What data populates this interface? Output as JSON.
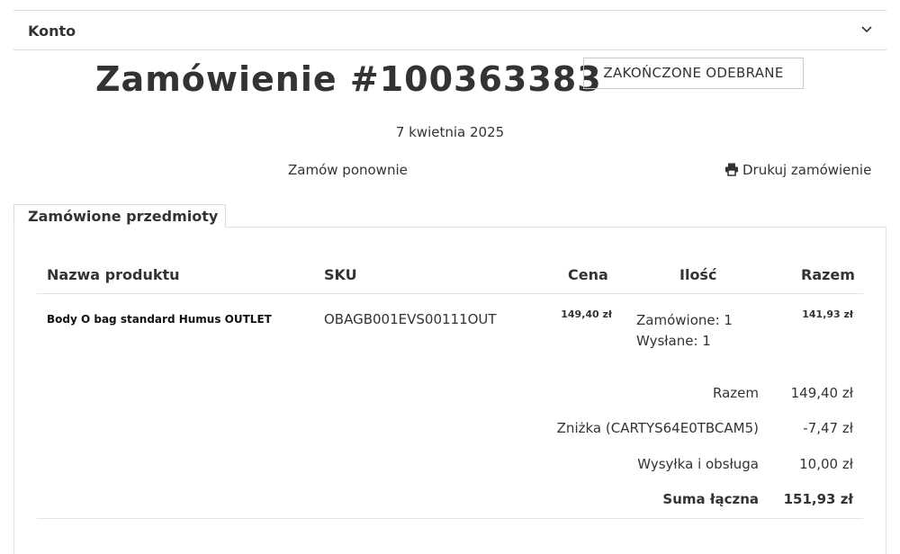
{
  "account": {
    "label": "Konto",
    "toggle_icon": "chevron-down-icon"
  },
  "order": {
    "title": "Zamówienie #100363383",
    "status": "ZAKOŃCZONE ODEBRANE",
    "date": "7 kwietnia 2025",
    "reorder_label": "Zamów ponownie",
    "print_label": "Drukuj zamówienie",
    "print_icon": "printer-icon"
  },
  "tabs": {
    "items_label": "Zamówione przedmioty"
  },
  "table": {
    "headers": {
      "name": "Nazwa produktu",
      "sku": "SKU",
      "price": "Cena",
      "qty": "Ilość",
      "total": "Razem"
    },
    "rows": [
      {
        "name": "Body O bag standard Humus OUTLET",
        "sku": "OBAGB001EVS00111OUT",
        "price": "149,40 zł",
        "qty_ordered": "Zamówione: 1",
        "qty_shipped": "Wysłane: 1",
        "total": "141,93 zł"
      }
    ]
  },
  "summary": {
    "subtotal_label": "Razem",
    "subtotal_value": "149,40 zł",
    "discount_label": "Zniżka (CARTYS64E0TBCAM5)",
    "discount_value": "-7,47 zł",
    "shipping_label": "Wysyłka i obsługa",
    "shipping_value": "10,00 zł",
    "grand_total_label": "Suma łączna",
    "grand_total_value": "151,93 zł"
  }
}
